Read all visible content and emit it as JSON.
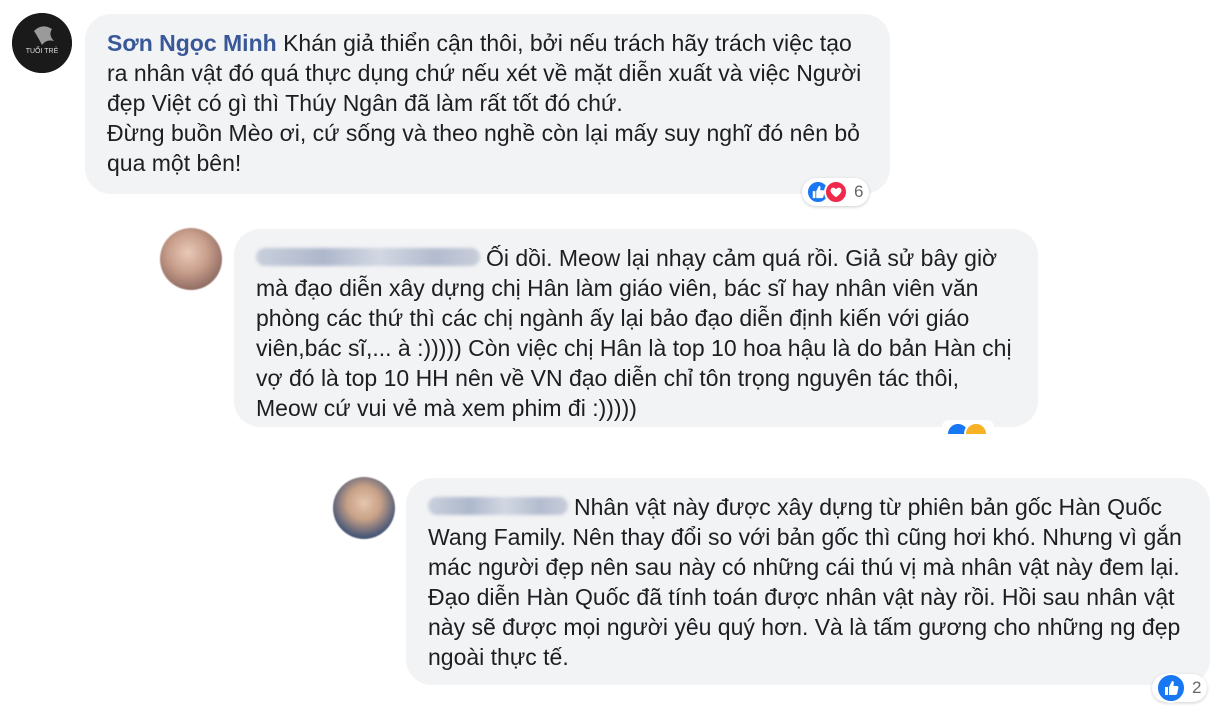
{
  "comments": [
    {
      "author": "Sơn Ngọc Minh",
      "text_lines": [
        "Khán giả thiển cận thôi, bởi nếu trách hãy trách việc tạo ra nhân vật đó quá thực dụng chứ nếu xét về mặt diễn xuất và việc Người đẹp Việt có gì thì Thúy Ngân đã làm rất tốt đó chứ.",
        "Đừng buồn Mèo ơi, cứ sống và theo nghề còn lại mấy suy nghĩ đó nên bỏ qua một bên!"
      ],
      "avatar_text": "TUỔI TRẺ",
      "reaction_count": "6",
      "reactions": [
        "like-icon",
        "love-icon"
      ]
    },
    {
      "author": "",
      "text": "Ối dồi. Meow lại nhạy cảm quá rồi. Giả sử bây giờ mà đạo diễn xây dựng chị Hân làm giáo viên, bác sĩ hay nhân viên văn phòng các thứ thì các chị ngành ấy lại bảo đạo diễn định kiến với giáo viên,bác sĩ,... à :))))) Còn việc chị Hân là top 10 hoa hậu là do bản Hàn chị vợ đó là top 10 HH nên về VN đạo diễn chỉ tôn trọng nguyên tác thôi, Meow cứ vui vẻ mà xem phim đi :)))))",
      "reactions": [
        "like-icon",
        "haha-icon"
      ]
    },
    {
      "author": "",
      "text": "Nhân vật này được xây dựng từ phiên bản gốc Hàn Quốc Wang Family. Nên thay đổi so với bản gốc thì cũng hơi khó. Nhưng vì gắn mác người đẹp nên sau này có những cái thú vị mà nhân vật này đem lại. Đạo diễn Hàn Quốc đã tính toán được nhân vật này rồi. Hồi sau nhân vật này sẽ được mọi người yêu quý hơn. Và là tấm gương cho những ng đẹp ngoài thực tế.",
      "reaction_count": "2",
      "reactions": [
        "like-icon"
      ]
    }
  ],
  "colors": {
    "author": "#385898",
    "bubble": "#f2f3f5",
    "like": "#1877f2",
    "love": "#f0284a",
    "haha": "#f7b125"
  }
}
